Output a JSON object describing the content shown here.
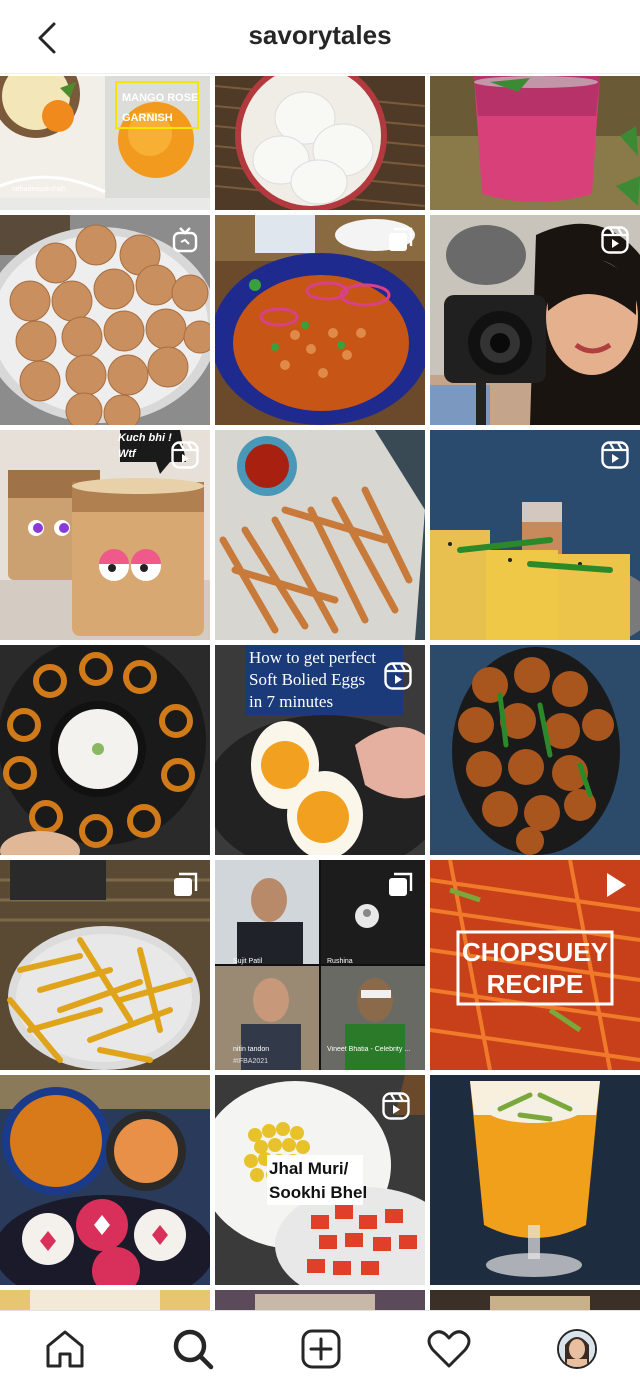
{
  "header": {
    "title": "savorytales",
    "back_icon": "chevron-left-icon"
  },
  "posts": [
    {
      "id": "mango-rose",
      "overlay": "MANGO ROSE\nGARNISH",
      "watermark": "nehadeepakshah",
      "icon": null
    },
    {
      "id": "idli",
      "icon": null
    },
    {
      "id": "jamun-drink",
      "icon": null
    },
    {
      "id": "pani-puri",
      "icon": "igtv-icon"
    },
    {
      "id": "chana-curry",
      "icon": "carousel-icon"
    },
    {
      "id": "camera-selfie",
      "icon": "reels-icon"
    },
    {
      "id": "cold-coffee",
      "overlay": "Kuch bhi ! Wtf",
      "icon": "reels-icon"
    },
    {
      "id": "cheese-straws",
      "icon": null
    },
    {
      "id": "dhokla",
      "icon": "reels-icon"
    },
    {
      "id": "jalebi",
      "icon": null
    },
    {
      "id": "boiled-eggs",
      "overlay": "How to get perfect\nSoft Bolied Eggs\nin 7 minutes",
      "icon": "reels-icon"
    },
    {
      "id": "fried-chicken",
      "icon": null
    },
    {
      "id": "sev-namkeen",
      "icon": "carousel-icon"
    },
    {
      "id": "video-call",
      "icon": "carousel-icon",
      "names": [
        "Sujit Patil",
        "Rushina",
        "nitin tandon",
        "Vineet Bhatia - Celebrity ..."
      ],
      "tag": "#IFBA2021"
    },
    {
      "id": "chopsuey",
      "overlay": "CHOPSUEY\nRECIPE",
      "icon": "play-icon"
    },
    {
      "id": "sambar-idli",
      "icon": null
    },
    {
      "id": "jhal-muri",
      "overlay": "Jhal Muri/\nSookhi Bhel",
      "icon": "reels-icon"
    },
    {
      "id": "mango-lassi",
      "icon": null
    }
  ],
  "tabbar": {
    "items": [
      {
        "name": "home",
        "icon": "home-icon"
      },
      {
        "name": "search",
        "icon": "search-icon",
        "active": true
      },
      {
        "name": "new-post",
        "icon": "plus-square-icon"
      },
      {
        "name": "activity",
        "icon": "heart-icon"
      },
      {
        "name": "profile",
        "icon": "avatar"
      }
    ]
  },
  "colors": {
    "text": "#262626",
    "border": "#efefef",
    "background": "#ffffff"
  }
}
